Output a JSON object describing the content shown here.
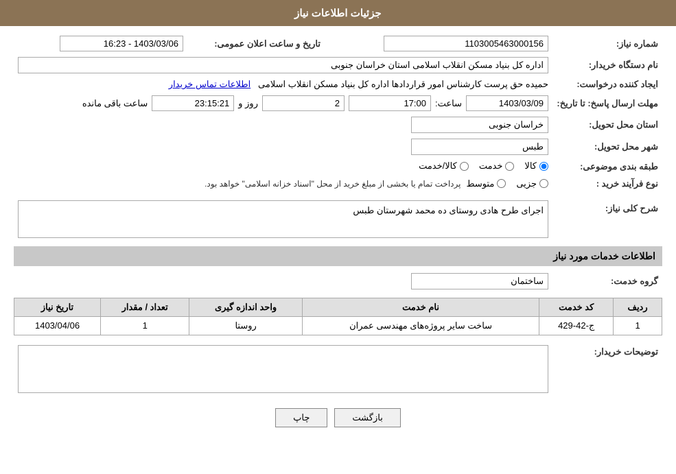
{
  "header": {
    "title": "جزئیات اطلاعات نیاز"
  },
  "fields": {
    "need_number_label": "شماره نیاز:",
    "need_number_value": "1103005463000156",
    "announcement_date_label": "تاریخ و ساعت اعلان عمومی:",
    "announcement_date_value": "1403/03/06 - 16:23",
    "buyer_org_label": "نام دستگاه خریدار:",
    "buyer_org_value": "اداره کل بنیاد مسکن انقلاب اسلامی استان خراسان جنوبی",
    "creator_label": "ایجاد کننده درخواست:",
    "creator_value": "حمیده حق پرست کارشناس امور قراردادها اداره کل بنیاد مسکن انقلاب اسلامی",
    "contact_link": "اطلاعات تماس خریدار",
    "deadline_label": "مهلت ارسال پاسخ: تا تاریخ:",
    "deadline_date": "1403/03/09",
    "deadline_time_label": "ساعت:",
    "deadline_time": "17:00",
    "deadline_days_label": "روز و",
    "deadline_days": "2",
    "remaining_label": "ساعت باقی مانده",
    "remaining_time": "23:15:21",
    "province_label": "استان محل تحویل:",
    "province_value": "خراسان جنوبی",
    "city_label": "شهر محل تحویل:",
    "city_value": "طبس",
    "category_label": "طبقه بندی موضوعی:",
    "category_options": [
      "کالا",
      "خدمت",
      "کالا/خدمت"
    ],
    "category_selected": "کالا",
    "purchase_type_label": "نوع فرآیند خرید :",
    "purchase_options": [
      "جزیی",
      "متوسط"
    ],
    "purchase_note": "پرداخت تمام یا بخشی از مبلغ خرید از محل \"اسناد خزانه اسلامی\" خواهد بود.",
    "description_section": "شرح کلی نیاز:",
    "description_value": "اجرای طرح هادی روستای ده محمد شهرستان طبس",
    "services_section": "اطلاعات خدمات مورد نیاز",
    "service_group_label": "گروه خدمت:",
    "service_group_value": "ساختمان",
    "table_headers": [
      "ردیف",
      "کد خدمت",
      "نام خدمت",
      "واحد اندازه گیری",
      "تعداد / مقدار",
      "تاریخ نیاز"
    ],
    "table_rows": [
      {
        "row": "1",
        "code": "ج-42-429",
        "name": "ساخت سایر پروژه‌های مهندسی عمران",
        "unit": "روستا",
        "quantity": "1",
        "date": "1403/04/06"
      }
    ],
    "buyer_notes_label": "توضیحات خریدار:",
    "buyer_notes_value": "",
    "btn_print": "چاپ",
    "btn_back": "بازگشت"
  }
}
